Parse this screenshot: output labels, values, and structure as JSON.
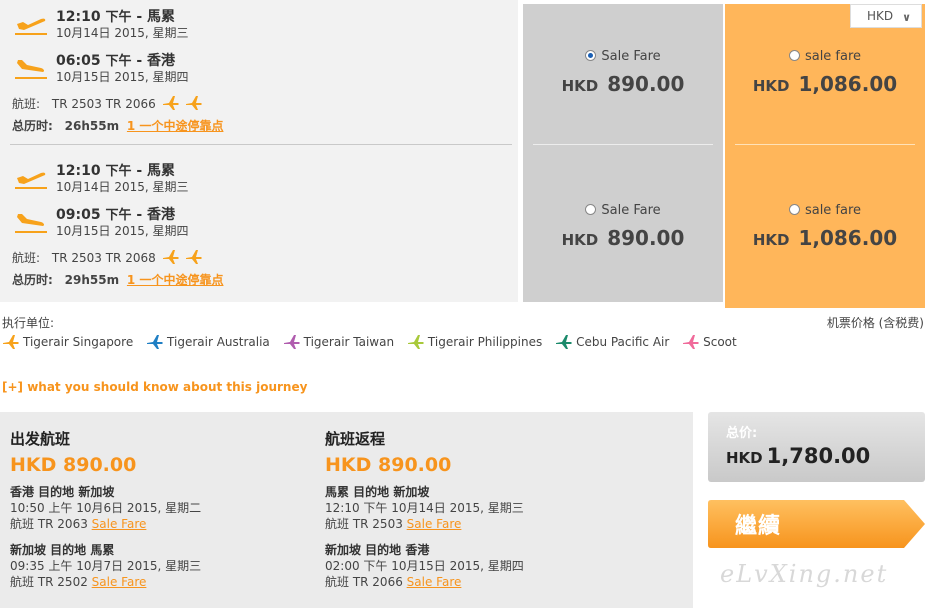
{
  "flights": [
    {
      "depart": {
        "time": "12:10",
        "ampm": "下午",
        "city": "馬累",
        "date": "10月14日 2015, 星期三"
      },
      "arrive": {
        "time": "06:05",
        "ampm": "下午",
        "city": "香港",
        "date": "10月15日 2015, 星期四"
      },
      "flight_label": "航班:",
      "flight_numbers": "TR 2503 TR 2066",
      "duration_label": "总历时:",
      "duration": "26h55m",
      "stops_link": "1 一个中途停靠点",
      "sale_fare": {
        "label": "Sale Fare",
        "currency": "HKD",
        "price": "890.00",
        "selected": true
      },
      "other_fare": {
        "label": "sale fare",
        "currency": "HKD",
        "price": "1,086.00",
        "selected": false
      }
    },
    {
      "depart": {
        "time": "12:10",
        "ampm": "下午",
        "city": "馬累",
        "date": "10月14日 2015, 星期三"
      },
      "arrive": {
        "time": "09:05",
        "ampm": "下午",
        "city": "香港",
        "date": "10月15日 2015, 星期四"
      },
      "flight_label": "航班:",
      "flight_numbers": "TR 2503 TR 2068",
      "duration_label": "总历时:",
      "duration": "29h55m",
      "stops_link": "1 一个中途停靠点",
      "sale_fare": {
        "label": "Sale Fare",
        "currency": "HKD",
        "price": "890.00",
        "selected": false
      },
      "other_fare": {
        "label": "sale fare",
        "currency": "HKD",
        "price": "1,086.00",
        "selected": false
      }
    }
  ],
  "currency_select": {
    "value": "HKD"
  },
  "operators_label": "执行单位:",
  "price_note": "机票价格 (含税费)",
  "operators": [
    {
      "name": "Tigerair Singapore",
      "color": "#f7a21b"
    },
    {
      "name": "Tigerair Australia",
      "color": "#1f7fc4"
    },
    {
      "name": "Tigerair Taiwan",
      "color": "#b05cae"
    },
    {
      "name": "Tigerair Philippines",
      "color": "#a8c93a"
    },
    {
      "name": "Cebu Pacific Air",
      "color": "#1b8a6b"
    },
    {
      "name": "Scoot",
      "color": "#f06a9a"
    }
  ],
  "know_link": "[+] what you should know about this journey",
  "summary": {
    "outbound": {
      "title": "出发航班",
      "price": "HKD 890.00",
      "legs": [
        {
          "route": "香港 目的地 新加坡",
          "datetime": "10:50 上午 10月6日 2015, 星期二",
          "flight": "航班 TR 2063",
          "fare": "Sale Fare"
        },
        {
          "route": "新加坡 目的地 馬累",
          "datetime": "09:35 上午 10月7日 2015, 星期三",
          "flight": "航班 TR 2502",
          "fare": "Sale Fare"
        }
      ]
    },
    "return": {
      "title": "航班返程",
      "price": "HKD 890.00",
      "legs": [
        {
          "route": "馬累 目的地 新加坡",
          "datetime": "12:10 下午 10月14日 2015, 星期三",
          "flight": "航班 TR 2503",
          "fare": "Sale Fare"
        },
        {
          "route": "新加坡 目的地 香港",
          "datetime": "02:00 下午 10月15日 2015, 星期四",
          "flight": "航班 TR 2066",
          "fare": "Sale Fare"
        }
      ]
    }
  },
  "total": {
    "label": "总价:",
    "currency": "HKD",
    "value": "1,780.00"
  },
  "continue_label": "繼續",
  "watermark": "eLvXing.net",
  "colors": {
    "accent": "#f7941d",
    "sale_column": "#cfcfcf",
    "orange_column": "#ffb65a"
  }
}
